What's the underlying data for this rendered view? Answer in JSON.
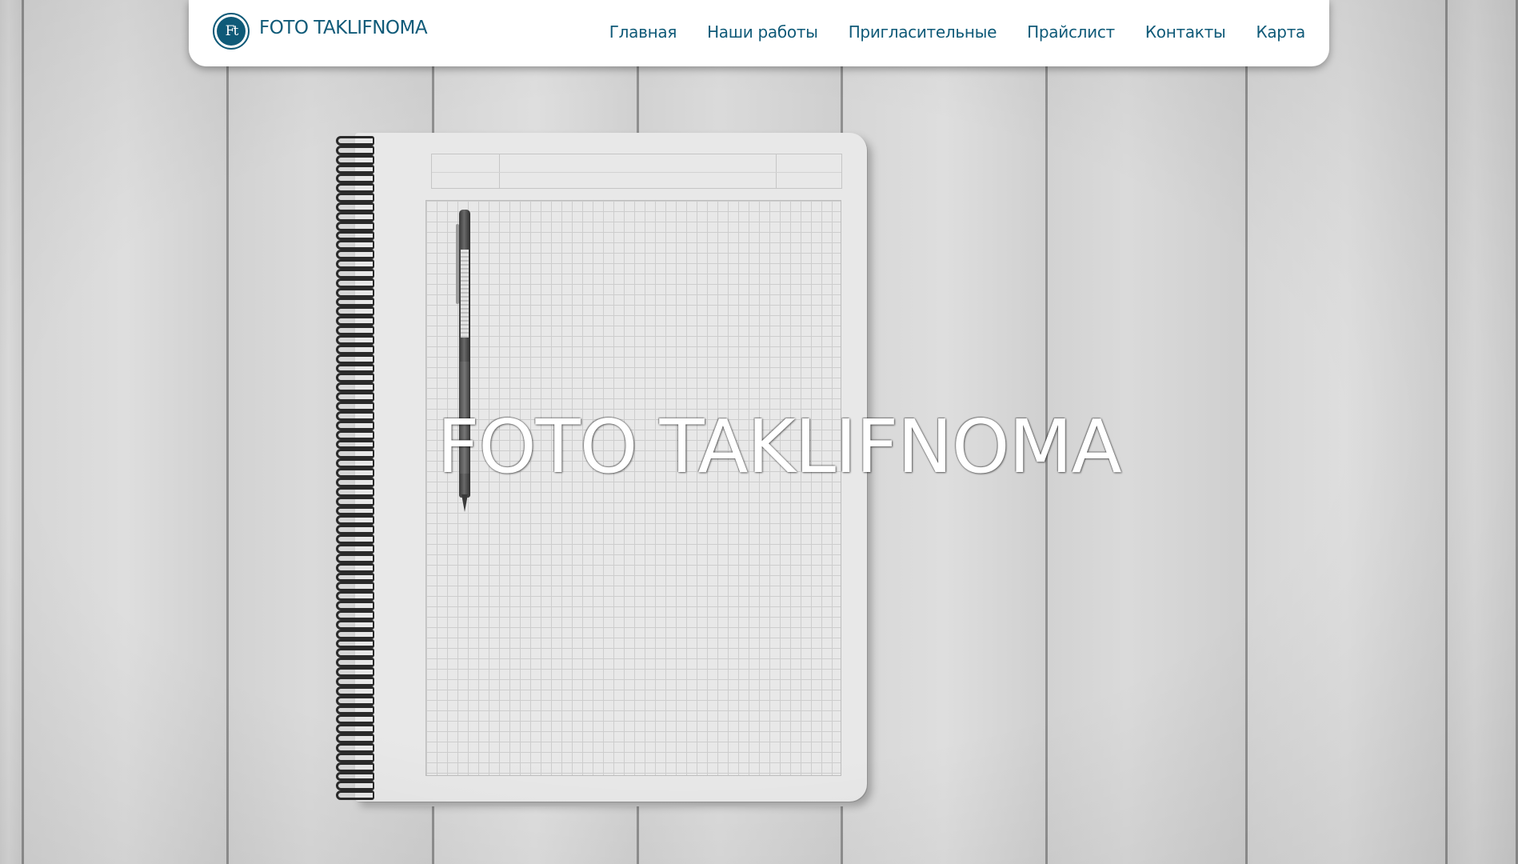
{
  "header": {
    "logo_mark": "Ft",
    "logo_text": "FOTO TAKLIFNOMA",
    "nav": [
      {
        "label": "Главная"
      },
      {
        "label": "Наши работы"
      },
      {
        "label": "Пригласительные"
      },
      {
        "label": "Прайслист"
      },
      {
        "label": "Контакты"
      },
      {
        "label": "Карта"
      }
    ]
  },
  "hero": {
    "title": "FOTO TAKLIFNOMA",
    "image_icon": "notebook-with-pen-image"
  },
  "colors": {
    "brand": "#0f5a78",
    "nav_background": "#ffffff",
    "hero_title": "#ffffff"
  }
}
